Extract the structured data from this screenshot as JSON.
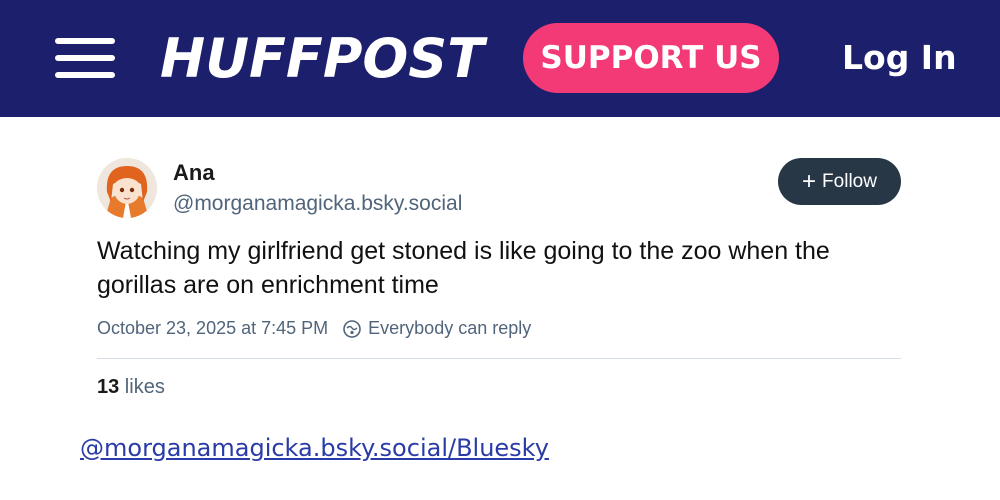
{
  "header": {
    "logo": "HUFFPOST",
    "support_label": "SUPPORT US",
    "login_label": "Log In",
    "colors": {
      "bar": "#1c1f6b",
      "support": "#f43a76"
    }
  },
  "post": {
    "author_name": "Ana",
    "author_handle": "@morganamagicka.bsky.social",
    "follow_label": "Follow",
    "text": "Watching my girlfriend get stoned is like going to the zoo when the gorillas are on enrichment time",
    "timestamp": "October 23, 2025 at 7:45 PM",
    "reply_setting": "Everybody can reply",
    "likes_count": "13",
    "likes_label": " likes",
    "icons": [
      "menu-icon",
      "plus-icon",
      "reply-settings-icon",
      "avatar"
    ]
  },
  "source_link": "@morganamagicka.bsky.social/Bluesky"
}
